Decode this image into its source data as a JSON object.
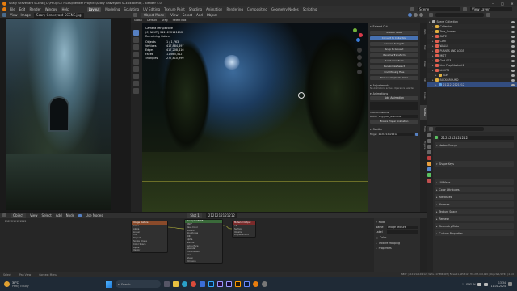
{
  "window": {
    "title": "Scary Graveyard SCENE [C:\\PROJECT FILES\\Blender Projects\\Scary Graveyard SCENE.blend] - Blender 4.0",
    "controls": [
      "–",
      "□",
      "✕"
    ]
  },
  "menu": [
    "File",
    "Edit",
    "Render",
    "Window",
    "Help"
  ],
  "workspace_tabs": [
    "Layout",
    "Modeling",
    "Sculpting",
    "UV Editing",
    "Texture Paint",
    "Shading",
    "Animation",
    "Rendering",
    "Compositing",
    "Geometry Nodes",
    "Scripting"
  ],
  "active_workspace": "Layout",
  "top_right": {
    "scene": "Scene",
    "view_layer": "View Layer"
  },
  "image_editor": {
    "header": [
      "View",
      "Image",
      "Scary Graveyard SCENE.jpg"
    ]
  },
  "viewport": {
    "header": [
      "Object Mode",
      "View",
      "Select",
      "Add",
      "Object"
    ],
    "sub_header": [
      "Global",
      "Default",
      "Drag",
      "Select Box"
    ],
    "info": {
      "title": "Camera Perspective",
      "subtitle": "(0) NEXT | 2121212121212",
      "collection": "Remaining Colors",
      "stats": [
        {
          "label": "Objects",
          "value": "1 / 1,763"
        },
        {
          "label": "Vertices",
          "value": "417,884,497"
        },
        {
          "label": "Edges",
          "value": "417,208,416"
        },
        {
          "label": "Faces",
          "value": "11,665,512"
        },
        {
          "label": "Triangles",
          "value": "277,410,999"
        }
      ]
    }
  },
  "tool_panel": {
    "title": "Extend Cut",
    "items": [
      "Smooth Mode",
      "Convert to Collection",
      "Convert to Lights",
      "Snap to Ground",
      "Rename Transform",
      "Reset Transform",
      "Randomize Select",
      "Find Missing Files",
      "Remove Duplicate Data"
    ],
    "adjustments": {
      "title": "Adjustments",
      "note": "No Animations active - Operators selected"
    },
    "animations": {
      "title": "Animations",
      "add": "Add Animation",
      "list_label": "Total Animations",
      "action": "Action",
      "action_value": "Eng/guile_animation",
      "extra": "Ensure Proper Animation"
    },
    "scatter": {
      "title": "Scatter",
      "target_label": "Target",
      "target_value": "2121212121212"
    }
  },
  "side_tabs": [
    "Item",
    "Tool",
    "View",
    "Edit",
    "Create",
    "Scatter",
    "Tools",
    "Physics"
  ],
  "outliner": {
    "search_placeholder": "",
    "items": [
      {
        "label": "Scene Collection",
        "depth": 0,
        "color": "#aaaaaa"
      },
      {
        "label": "Collection",
        "depth": 1,
        "color": "#e0b040"
      },
      {
        "label": "Tree_Groves",
        "depth": 1,
        "color": "#e0b040"
      },
      {
        "label": "GATE",
        "depth": 1,
        "color": "#e06050"
      },
      {
        "label": "CART",
        "depth": 1,
        "color": "#e06050"
      },
      {
        "label": "WALLS",
        "depth": 1,
        "color": "#e06050"
      },
      {
        "label": "PLANTS AND LOGS",
        "depth": 1,
        "color": "#e06050"
      },
      {
        "label": "MIST",
        "depth": 1,
        "color": "#e06050"
      },
      {
        "label": "Grid.003",
        "depth": 1,
        "color": "#e06050"
      },
      {
        "label": "Line Prop Nested.1",
        "depth": 1,
        "color": "#e06050"
      },
      {
        "label": "LIGHTS",
        "depth": 1,
        "color": "#e06050"
      },
      {
        "label": "Sun",
        "depth": 2,
        "color": "#e0b040"
      },
      {
        "label": "BACKGROUND",
        "depth": 1,
        "color": "#e0b040"
      },
      {
        "label": "2121212121212",
        "depth": 2,
        "color": "#60a0e0"
      }
    ],
    "selected_sub": "2121212121212"
  },
  "properties": {
    "object_name": "2121212121212",
    "sections": [
      "Vertex Groups",
      "Shape Keys",
      "UV Maps",
      "Color Attributes",
      "Attributes",
      "Normals",
      "Texture Space",
      "Remesh",
      "Geometry Data",
      "Custom Properties"
    ]
  },
  "node_editor": {
    "header": [
      "Object",
      "View",
      "Select",
      "Add",
      "Node",
      "Use Nodes"
    ],
    "material": "2121212121212",
    "slot": "Slot 1",
    "node_panel": {
      "title": "Node",
      "name_label": "Name",
      "name_value": "Image Texture",
      "label_label": "Label",
      "color_label": "Color",
      "texture_mapping": "Texture Mapping",
      "properties": "Properties"
    },
    "nodes": [
      {
        "title": "Image Texture",
        "rows": [
          "Color",
          "Alpha",
          "Linear",
          "Flat",
          "Repeat",
          "Single Image",
          "Color Space",
          "Alpha",
          "Vector"
        ]
      },
      {
        "title": "Principled BSDF",
        "rows": [
          "BSDF",
          "Base Color",
          "Metallic",
          "Roughness",
          "IOR",
          "Alpha",
          "Normal",
          "Subsurface",
          "Specular",
          "Transmission",
          "Coat",
          "Sheen",
          "Emission"
        ]
      },
      {
        "title": "Material Output",
        "rows": [
          "All",
          "Surface",
          "Volume",
          "Displacement"
        ]
      }
    ]
  },
  "status_bar": {
    "left": [
      "Select",
      "Pan View",
      "Context Menu"
    ],
    "right": "NEXT | 2121212121212 | Verts 417,884,497 | Faces 11,665,512 | Tris 277,410,999 | Objects 1/1,763 | 4.0.0"
  },
  "taskbar": {
    "weather_temp": "30°C",
    "weather_desc": "Partly cloudy",
    "search_placeholder": "Search",
    "time": "13:34",
    "date": "11-01-2024",
    "lang": "ENG IN"
  }
}
